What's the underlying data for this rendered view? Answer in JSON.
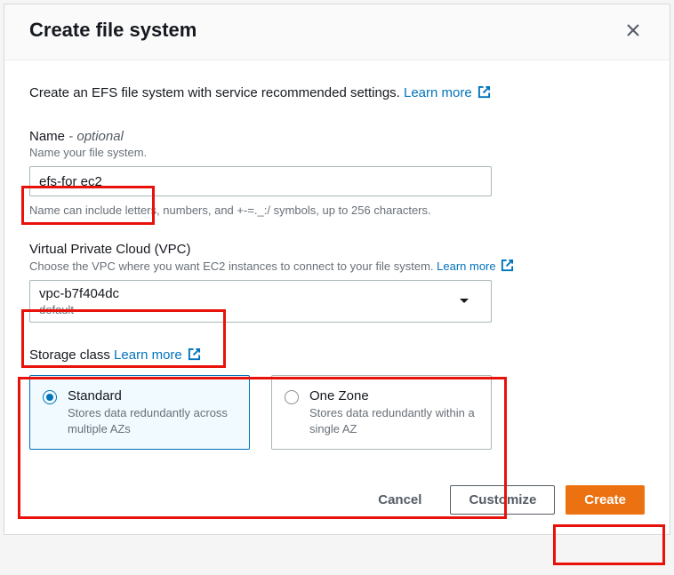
{
  "header": {
    "title": "Create file system"
  },
  "intro": {
    "text": "Create an EFS file system with service recommended settings. ",
    "learn_more": "Learn more"
  },
  "name_field": {
    "label_main": "Name",
    "label_optional": " - optional",
    "hint": "Name your file system.",
    "value": "efs-for ec2",
    "sub_hint": "Name can include letters, numbers, and +-=._:/ symbols, up to 256 characters."
  },
  "vpc_field": {
    "label": "Virtual Private Cloud (VPC)",
    "hint_pre": "Choose the VPC where you want EC2 instances to connect to your file system. ",
    "learn_more": "Learn more",
    "value": "vpc-b7f404dc",
    "secondary": "default"
  },
  "storage": {
    "title_pre": "Storage class ",
    "learn_more": "Learn more",
    "options": [
      {
        "label": "Standard",
        "desc": "Stores data redundantly across multiple AZs",
        "selected": true
      },
      {
        "label": "One Zone",
        "desc": "Stores data redundantly within a single AZ",
        "selected": false
      }
    ]
  },
  "footer": {
    "cancel": "Cancel",
    "customize": "Customize",
    "create": "Create"
  }
}
